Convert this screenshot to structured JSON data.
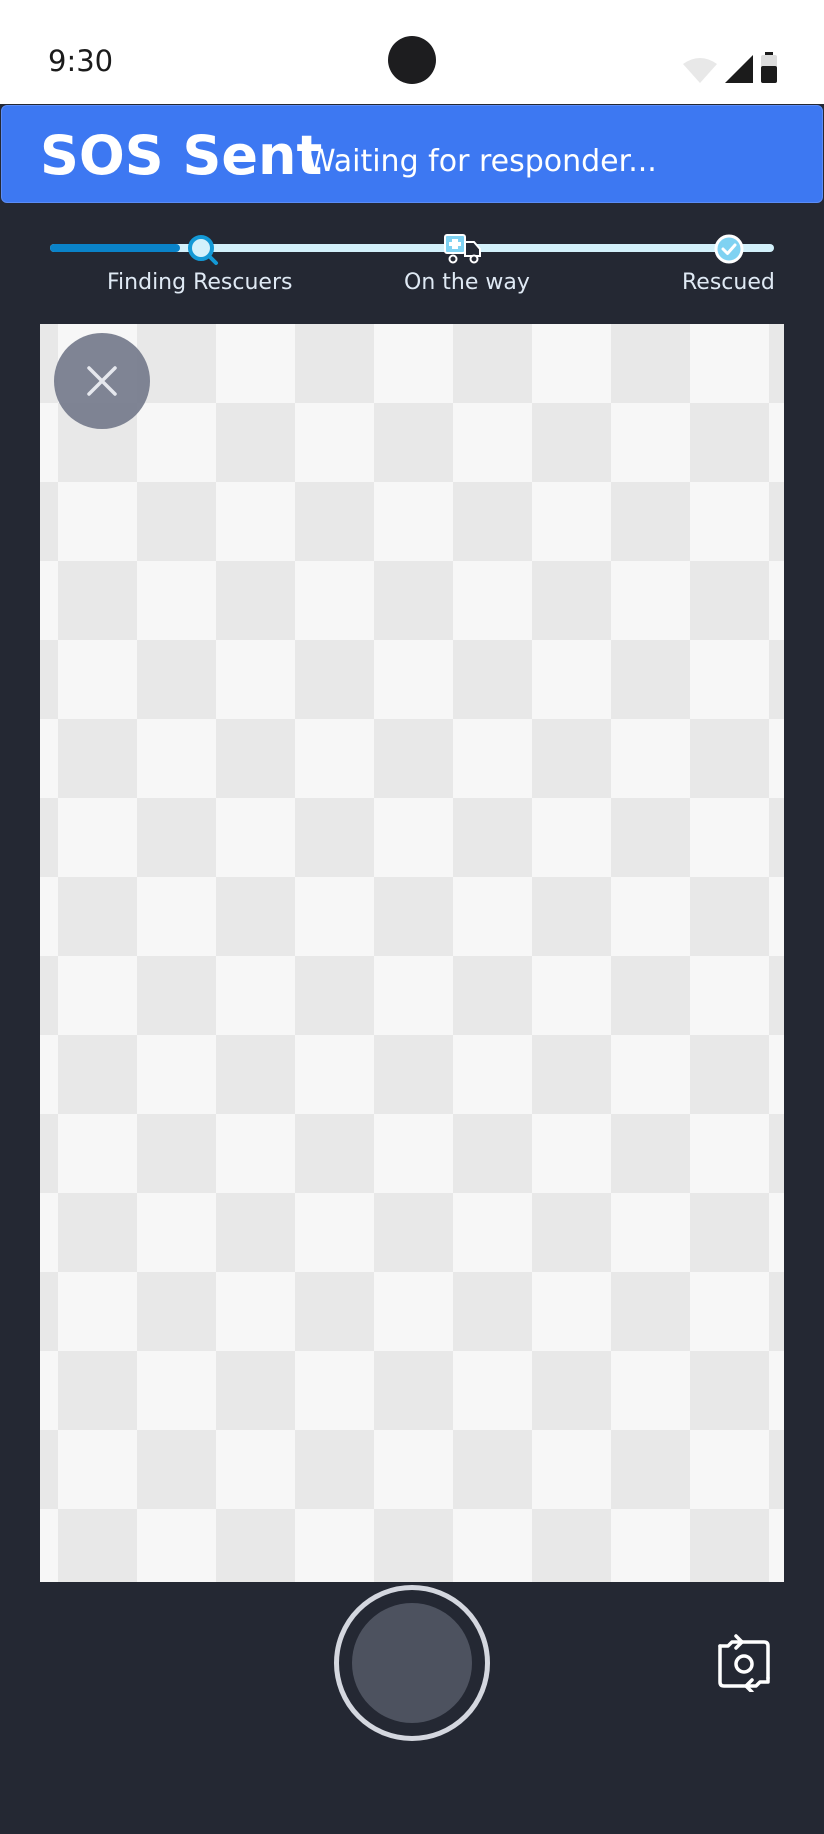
{
  "status_bar": {
    "time": "9:30"
  },
  "banner": {
    "title": "SOS Sent",
    "subtitle": "Waiting for responder..."
  },
  "progress": {
    "current_step": 0,
    "fraction": 0.18,
    "steps": [
      {
        "label": "Finding Rescuers",
        "icon": "search-icon"
      },
      {
        "label": "On the way",
        "icon": "truck-icon"
      },
      {
        "label": "Rescued",
        "icon": "check-circle-icon"
      }
    ]
  },
  "colors": {
    "banner": "#3d78f2",
    "progress_fill": "#0a83c9",
    "progress_track": "#d3f1fb",
    "background": "#242833"
  },
  "controls": {
    "close_icon": "close-icon",
    "shutter": "shutter-button",
    "flip_icon": "flip-camera-icon"
  }
}
